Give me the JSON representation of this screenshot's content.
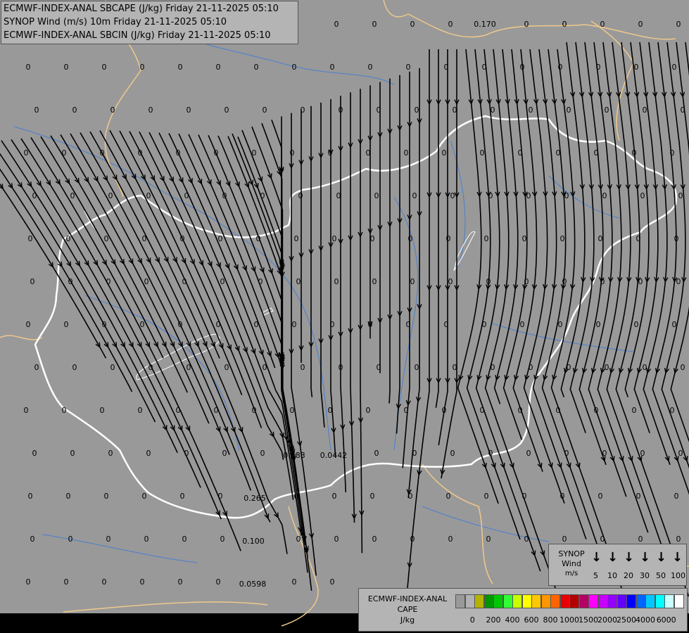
{
  "title": {
    "lines": [
      "ECMWF-INDEX-ANAL SBCAPE (J/kg) Friday 21-11-2025 05:10",
      "SYNOP Wind (m/s) 10m Friday 21-11-2025 05:10",
      "ECMWF-INDEX-ANAL SBCIN (J/kg) Friday 21-11-2025 05:10"
    ]
  },
  "colors": {
    "background": "#999999",
    "border": "#f0c88c",
    "country_border": "#ffffff",
    "river": "#4a7fd0",
    "streamline": "#000000"
  },
  "wind_legend": {
    "title": [
      "SYNOP",
      "Wind",
      "m/s"
    ],
    "speeds": [
      "5",
      "10",
      "20",
      "30",
      "50",
      "100"
    ],
    "arrow_icon": "down-arrow-icon"
  },
  "cape_legend": {
    "title": [
      "ECMWF-INDEX-ANAL",
      "CAPE",
      "J/kg"
    ],
    "colors": [
      "#999999",
      "#b2b2b2",
      "#b4b400",
      "#009600",
      "#00c800",
      "#32ff32",
      "#c8ff00",
      "#ffff00",
      "#ffc800",
      "#ff9600",
      "#ff6400",
      "#e60000",
      "#b40000",
      "#b40064",
      "#ff00ff",
      "#c800ff",
      "#9600ff",
      "#6400ff",
      "#0000ff",
      "#0064ff",
      "#00c8ff",
      "#00ffff",
      "#c8ffff",
      "#ffffff"
    ],
    "ticks": [
      "0",
      "200",
      "400",
      "600",
      "800",
      "1000",
      "1500",
      "2000",
      "2500",
      "4000",
      "6000"
    ]
  },
  "labels": {
    "zeros": "0",
    "special": [
      "0.170",
      "0.183",
      "0.0442",
      "0.265",
      "0.100",
      "0.0598"
    ]
  }
}
